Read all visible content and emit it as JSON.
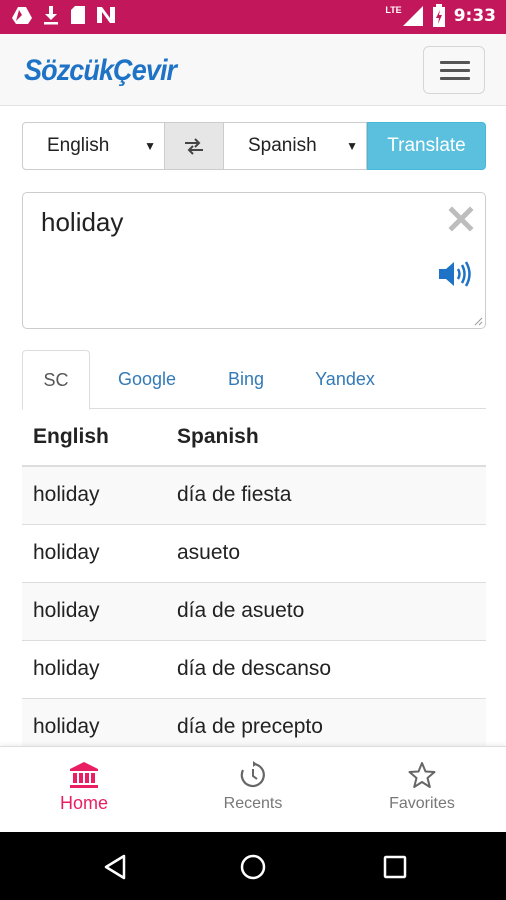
{
  "status_bar": {
    "time": "9:33",
    "network_label": "LTE",
    "icons": [
      "drive-icon",
      "download-icon",
      "sd-card-icon",
      "n-app-icon",
      "signal-icon",
      "battery-icon"
    ]
  },
  "header": {
    "logo": "SözcükÇevir",
    "menu_icon": "hamburger-menu-icon"
  },
  "language_bar": {
    "source_language": "English",
    "target_language": "Spanish",
    "swap_icon": "swap-arrows-icon",
    "translate_label": "Translate"
  },
  "input": {
    "value": "holiday"
  },
  "tabs": [
    {
      "label": "SC",
      "active": true
    },
    {
      "label": "Google",
      "active": false
    },
    {
      "label": "Bing",
      "active": false
    },
    {
      "label": "Yandex",
      "active": false
    }
  ],
  "results": {
    "headers": [
      "English",
      "Spanish"
    ],
    "rows": [
      [
        "holiday",
        "día de fiesta"
      ],
      [
        "holiday",
        "asueto"
      ],
      [
        "holiday",
        "día de asueto"
      ],
      [
        "holiday",
        "día de descanso"
      ],
      [
        "holiday",
        "día de precepto"
      ]
    ]
  },
  "bottom_nav": [
    {
      "label": "Home",
      "icon": "bank-building-icon",
      "active": true
    },
    {
      "label": "Recents",
      "icon": "history-icon",
      "active": false
    },
    {
      "label": "Favorites",
      "icon": "star-icon",
      "active": false
    }
  ],
  "colors": {
    "status_bar": "#c2185b",
    "accent": "#e91e63",
    "logo": "#1f73c6",
    "translate_button": "#5bc0de",
    "link": "#337ab7"
  }
}
